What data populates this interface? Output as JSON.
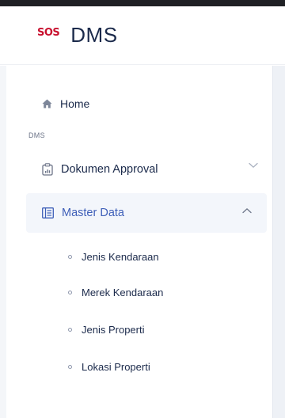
{
  "brand": {
    "logo_text": "SOS",
    "app_name": "DMS",
    "logo_color": "#c8102e"
  },
  "sidebar": {
    "home": {
      "label": "Home",
      "icon": "home-icon"
    },
    "section_label": "DMS",
    "items": [
      {
        "label": "Dokumen Approval",
        "icon": "clipboard-chart-icon",
        "expanded": false
      },
      {
        "label": "Master Data",
        "icon": "list-panel-icon",
        "expanded": true,
        "active": true
      }
    ],
    "submenu": [
      {
        "label": "Jenis Kendaraan"
      },
      {
        "label": "Merek Kendaraan"
      },
      {
        "label": "Jenis Properti"
      },
      {
        "label": "Lokasi Properti"
      }
    ]
  },
  "colors": {
    "text_primary": "#1b2a4b",
    "accent": "#3e5fb8",
    "active_bg": "#f3f6fb",
    "topbar": "#1f2024"
  }
}
